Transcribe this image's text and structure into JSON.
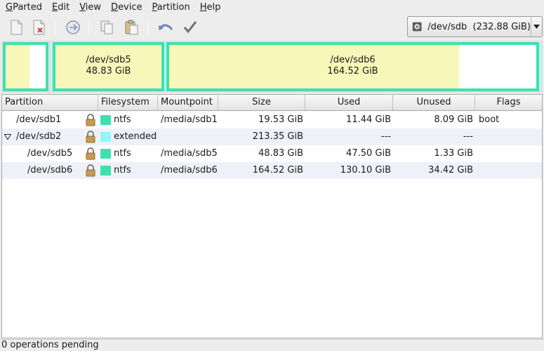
{
  "menu": [
    {
      "mnemonic": "G",
      "rest": "Parted"
    },
    {
      "mnemonic": "E",
      "rest": "dit"
    },
    {
      "mnemonic": "V",
      "rest": "iew"
    },
    {
      "mnemonic": "D",
      "rest": "evice"
    },
    {
      "mnemonic": "P",
      "rest": "artition"
    },
    {
      "mnemonic": "H",
      "rest": "elp"
    }
  ],
  "toolbar": {
    "icons": [
      "new-partition-icon",
      "delete-partition-icon",
      "resize-move-icon",
      "copy-icon",
      "paste-icon",
      "undo-icon",
      "apply-icon"
    ]
  },
  "device": {
    "selected": "/dev/sdb  (232.88 GiB)",
    "icon": "hard-disk-icon"
  },
  "diskmap": {
    "unlabeled_block_used_fraction": 0.6,
    "sdb5": {
      "name": "/dev/sdb5",
      "size": "48.83 GiB",
      "used_fraction": 1.0
    },
    "sdb6": {
      "name": "/dev/sdb6",
      "size": "164.52 GiB",
      "used_fraction": 0.79
    }
  },
  "colors": {
    "ntfs": "#3fe0ae",
    "extended": "#8ff8f8",
    "used": "#f7f7b9",
    "extended_bg": "#b6f6f6"
  },
  "table": {
    "columns": [
      "Partition",
      "Filesystem",
      "Mountpoint",
      "Size",
      "Used",
      "Unused",
      "Flags"
    ],
    "rows": [
      {
        "partition": "/dev/sdb1",
        "filesystem": "ntfs",
        "mountpoint": "/media/sdb1",
        "size": "19.53 GiB",
        "used": "11.44 GiB",
        "unused": "8.09 GiB",
        "flags": "boot"
      },
      {
        "partition": "/dev/sdb2",
        "filesystem": "extended",
        "mountpoint": "",
        "size": "213.35 GiB",
        "used": "---",
        "unused": "---",
        "flags": ""
      },
      {
        "partition": "/dev/sdb5",
        "filesystem": "ntfs",
        "mountpoint": "/media/sdb5",
        "size": "48.83 GiB",
        "used": "47.50 GiB",
        "unused": "1.33 GiB",
        "flags": ""
      },
      {
        "partition": "/dev/sdb6",
        "filesystem": "ntfs",
        "mountpoint": "/media/sdb6",
        "size": "164.52 GiB",
        "used": "130.10 GiB",
        "unused": "34.42 GiB",
        "flags": ""
      }
    ]
  },
  "status": "0 operations pending"
}
